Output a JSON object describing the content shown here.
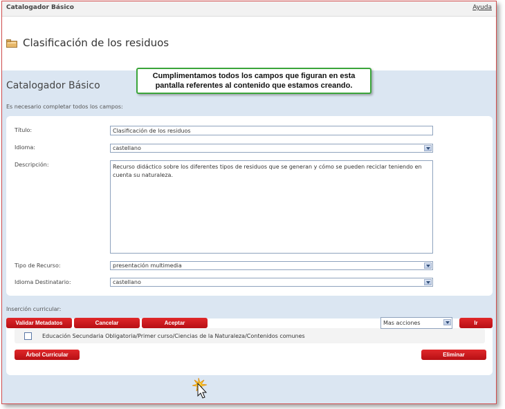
{
  "topbar": {
    "app_title": "Catalogador Básico",
    "help_link": "Ayuda"
  },
  "page": {
    "title": "Clasificación de los residuos",
    "icon": "folder-icon"
  },
  "callout": {
    "line1": "Cumplimentamos todos los campos que figuran en esta",
    "line2": "pantalla referentes al contenido que estamos creando."
  },
  "main": {
    "section_title": "Catalogador Básico",
    "required_note": "Es necesario completar todos los campos:"
  },
  "form": {
    "titulo_label": "Título:",
    "titulo_value": "Clasificación de los residuos",
    "idioma_label": "Idioma:",
    "idioma_value": "castellano",
    "descripcion_label": "Descripción:",
    "descripcion_value": "Recurso didáctico sobre los diferentes tipos de residuos que se generan y cómo se pueden reciclar teniendo en cuenta su naturaleza.",
    "tipo_label": "Tipo de Recurso:",
    "tipo_value": "presentación multimedia",
    "idioma_dest_label": "Idioma Destinatario:",
    "idioma_dest_value": "castellano"
  },
  "curricular": {
    "label": "Inserción curricular:",
    "item": "Educación Secundaria Obligatoria/Primer curso/Ciencias de la Naturaleza/Contenidos comunes",
    "arbol_button": "Árbol Curricular",
    "eliminar_button": "Eliminar"
  },
  "footer": {
    "validar_button": "Validar Metadatos",
    "cancelar_button": "Cancelar",
    "aceptar_button": "Aceptar",
    "acciones_value": "Mas acciones",
    "ir_button": "Ir"
  },
  "colors": {
    "accent_red": "#d0191d",
    "panel_blue": "#dbe6f2",
    "callout_green": "#3aa53a"
  }
}
